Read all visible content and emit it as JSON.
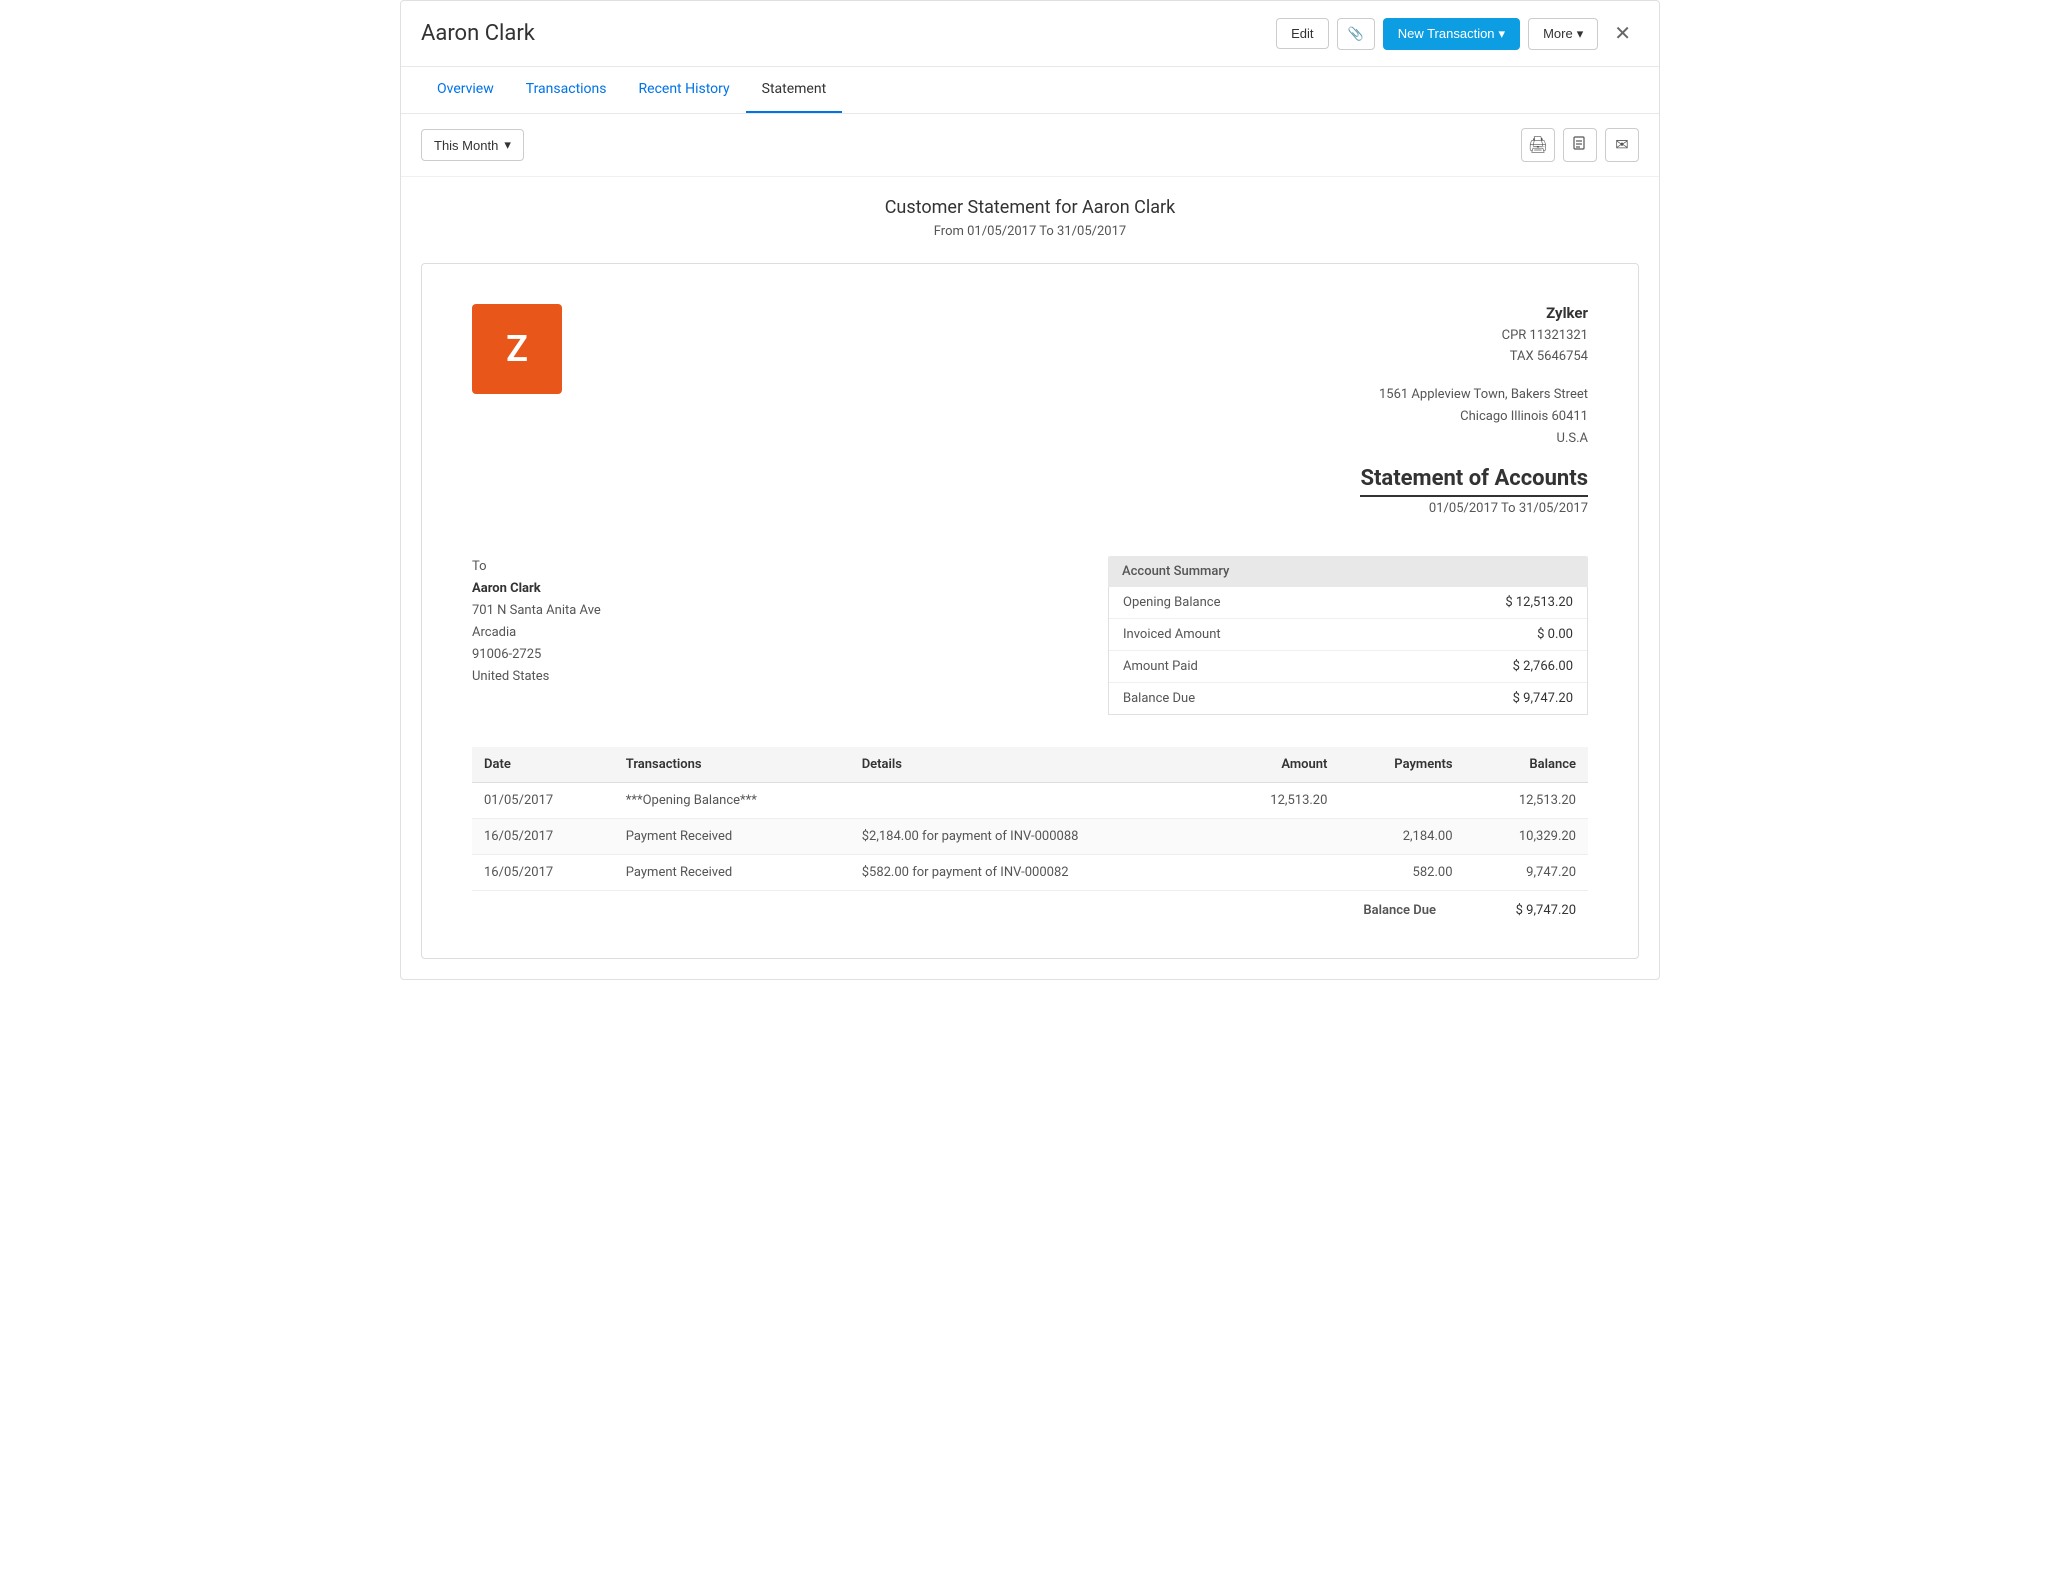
{
  "app": {
    "title": "Aaron Clark"
  },
  "header": {
    "edit_label": "Edit",
    "attach_icon": "📎",
    "new_transaction_label": "New Transaction",
    "more_label": "More",
    "close_icon": "✕"
  },
  "tabs": [
    {
      "id": "overview",
      "label": "Overview"
    },
    {
      "id": "transactions",
      "label": "Transactions"
    },
    {
      "id": "recent-history",
      "label": "Recent History"
    },
    {
      "id": "statement",
      "label": "Statement",
      "active": true
    }
  ],
  "toolbar": {
    "period_label": "This Month",
    "print_icon": "🖨",
    "download_icon": "📄",
    "email_icon": "✉"
  },
  "statement": {
    "heading": "Customer Statement for Aaron Clark",
    "date_range_label": "From 01/05/2017 To 31/05/2017",
    "company": {
      "logo_letter": "Z",
      "name": "Zylker",
      "cpr": "CPR 11321321",
      "tax": "TAX 5646754",
      "address_line1": "1561 Appleview Town, Bakers Street",
      "address_line2": "Chicago Illinois 60411",
      "address_line3": "U.S.A"
    },
    "statement_of_accounts_title": "Statement of Accounts",
    "statement_period": "01/05/2017 To 31/05/2017",
    "to_label": "To",
    "customer": {
      "name": "Aaron Clark",
      "address1": "701 N Santa Anita Ave",
      "city": "Arcadia",
      "zip": "91006-2725",
      "country": "United States"
    },
    "account_summary": {
      "header": "Account Summary",
      "rows": [
        {
          "label": "Opening Balance",
          "value": "$ 12,513.20"
        },
        {
          "label": "Invoiced Amount",
          "value": "$ 0.00"
        },
        {
          "label": "Amount Paid",
          "value": "$ 2,766.00"
        },
        {
          "label": "Balance Due",
          "value": "$ 9,747.20"
        }
      ]
    },
    "table": {
      "columns": [
        "Date",
        "Transactions",
        "Details",
        "Amount",
        "Payments",
        "Balance"
      ],
      "rows": [
        {
          "date": "01/05/2017",
          "transaction": "***Opening Balance***",
          "details": "",
          "amount": "12,513.20",
          "payments": "",
          "balance": "12,513.20"
        },
        {
          "date": "16/05/2017",
          "transaction": "Payment Received",
          "details": "$2,184.00 for payment of INV-000088",
          "amount": "",
          "payments": "2,184.00",
          "balance": "10,329.20"
        },
        {
          "date": "16/05/2017",
          "transaction": "Payment Received",
          "details": "$582.00 for payment of INV-000082",
          "amount": "",
          "payments": "582.00",
          "balance": "9,747.20"
        }
      ],
      "balance_due_label": "Balance Due",
      "balance_due_value": "$ 9,747.20"
    }
  }
}
